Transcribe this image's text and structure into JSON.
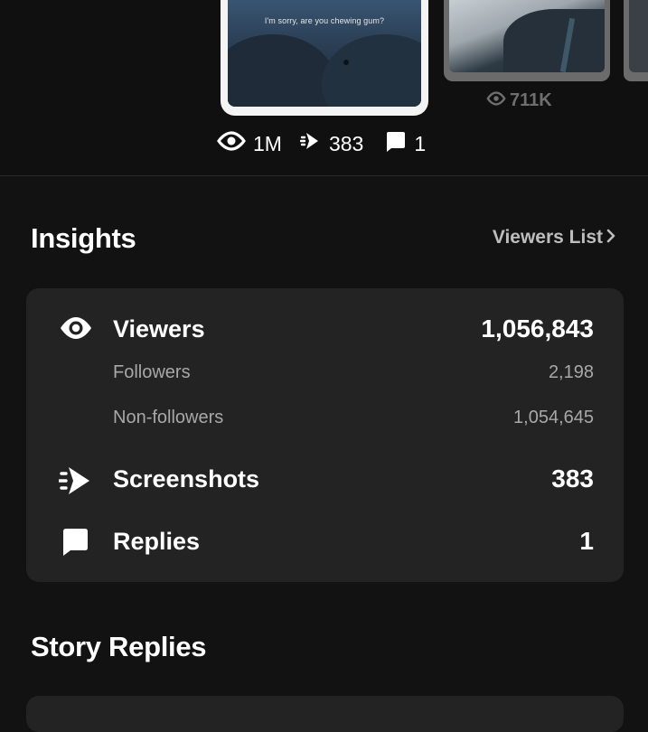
{
  "story": {
    "caption": "I'm sorry, are you chewing gum?",
    "side_views": "711K",
    "stats": {
      "views": "1M",
      "screenshots": "383",
      "replies": "1"
    }
  },
  "insights": {
    "title": "Insights",
    "viewers_link": "Viewers List",
    "rows": {
      "viewers": {
        "label": "Viewers",
        "value": "1,056,843"
      },
      "followers": {
        "label": "Followers",
        "value": "2,198"
      },
      "non_followers": {
        "label": "Non-followers",
        "value": "1,054,645"
      },
      "screenshots": {
        "label": "Screenshots",
        "value": "383"
      },
      "replies": {
        "label": "Replies",
        "value": "1"
      }
    }
  },
  "story_replies": {
    "title": "Story Replies"
  },
  "icons": [
    "eye-icon",
    "screenshot-arrow-icon",
    "chat-bubble-icon",
    "chevron-right-icon"
  ],
  "colors": {
    "background": "#121212",
    "card": "#232323",
    "muted_text": "#a8a8a8",
    "link_text": "#bdbdbd"
  }
}
